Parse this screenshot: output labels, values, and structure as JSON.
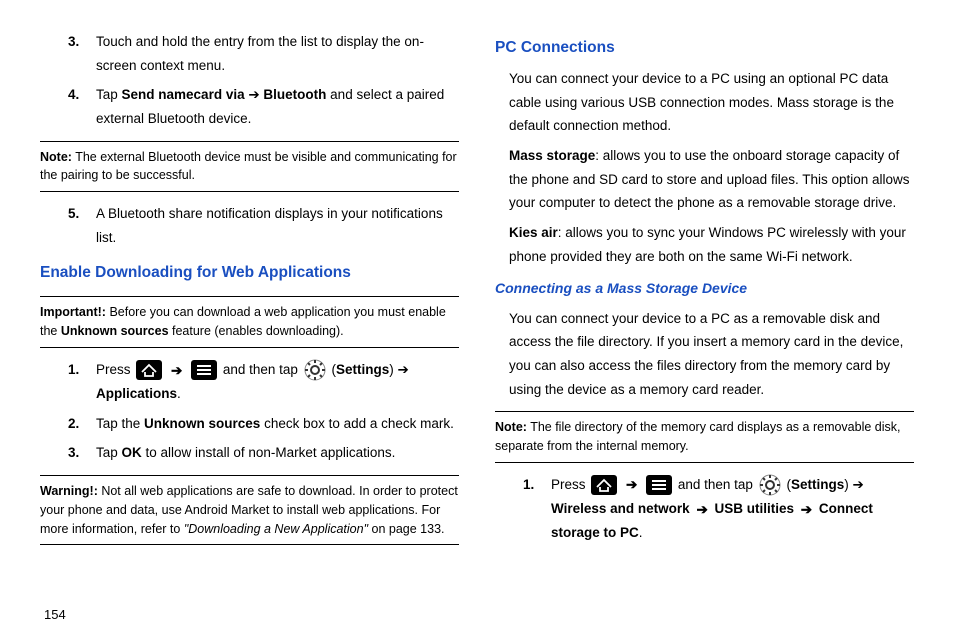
{
  "pageNumber": "154",
  "left": {
    "step3": {
      "num": "3.",
      "text": "Touch and hold the entry from the list to display the on-screen context menu."
    },
    "step4": {
      "num": "4.",
      "pre": "Tap ",
      "bold1": "Send namecard via",
      "arrow": " ➔ ",
      "bold2": "Bluetooth",
      "post": " and select a paired external Bluetooth device."
    },
    "note1": {
      "label": "Note:",
      "text": " The external Bluetooth device must be visible and communicating for the pairing to be successful."
    },
    "step5": {
      "num": "5.",
      "text": "A Bluetooth share notification displays in your notifications list."
    },
    "heading1": "Enable Downloading for Web Applications",
    "important1": {
      "label": "Important!:",
      "pre": " Before you can download a web application you must enable the ",
      "bold": "Unknown sources",
      "post": " feature (enables downloading)."
    },
    "dl1": {
      "num": "1.",
      "press": "Press ",
      "andthen": " and then tap ",
      "settings": "Settings",
      "arrow": " ➔ ",
      "apps": "Applications",
      "dot": "."
    },
    "dl2": {
      "num": "2.",
      "pre": "Tap the ",
      "bold": "Unknown sources",
      "post": " check box to add a check mark."
    },
    "dl3": {
      "num": "3.",
      "pre": "Tap ",
      "bold": "OK",
      "post": " to allow install of non-Market applications."
    },
    "warning1": {
      "label": "Warning!:",
      "pre": " Not all web applications are safe to download. In order to protect your phone and data, use Android Market to install web applications. For more information, refer to ",
      "ital": "\"Downloading a New Application\"",
      "post": " on page 133."
    }
  },
  "right": {
    "heading1": "PC Connections",
    "p1": "You can connect your device to a PC using an optional PC data cable using various USB connection modes. Mass storage is the default connection method.",
    "mass": {
      "bold": "Mass storage",
      "text": ": allows you to use the onboard storage capacity of the phone and SD card to store and upload files. This option allows your computer to detect the phone as a removable storage drive."
    },
    "kies": {
      "bold": "Kies air",
      "text": ": allows you to sync your Windows PC wirelessly with your phone provided they are both on the same Wi-Fi network."
    },
    "sub1": "Connecting as a Mass Storage Device",
    "p2": "You can connect your device to a PC as a removable disk and access the file directory. If you insert a memory card in the device, you can also access the files directory from the memory card by using the device as a memory card reader.",
    "note1": {
      "label": "Note:",
      "text": " The file directory of the memory card displays as a removable disk, separate from the internal memory."
    },
    "ms1": {
      "num": "1.",
      "press": "Press ",
      "andthen": " and then tap ",
      "settings": "Settings",
      "arrow": " ➔ ",
      "wnet": "Wireless and network ",
      "usb": " USB utilities ",
      "connect": " Connect storage to PC",
      "dot": "."
    }
  }
}
